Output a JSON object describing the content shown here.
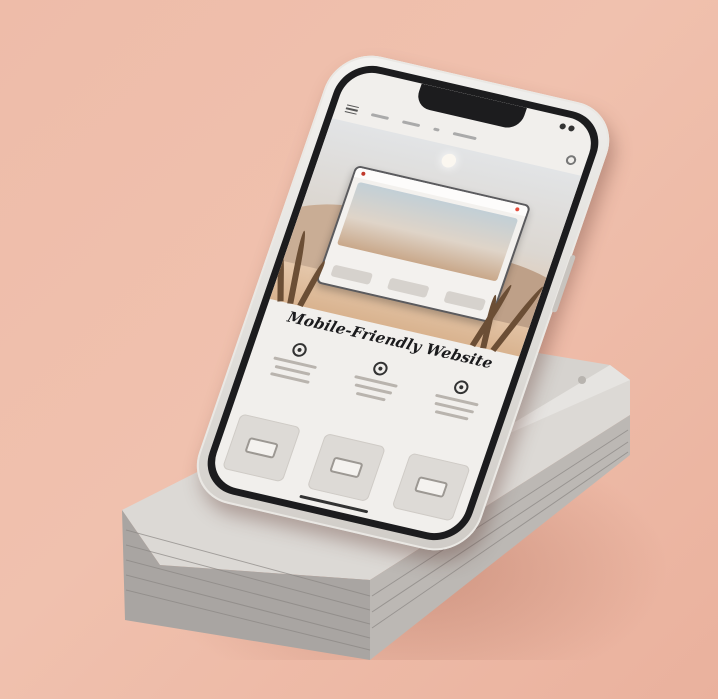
{
  "headline": "Mobile-Friendly Website",
  "colors": {
    "background": "#eebca9",
    "phone_frame": "#1c1c1e",
    "phone_shell": "#e4e2df",
    "screen": "#f1efec"
  },
  "icons": {
    "menu": "hamburger-icon",
    "settings": "gear-icon",
    "features": [
      "location-icon",
      "location-icon",
      "eye-icon"
    ],
    "tiles": [
      "image-icon",
      "image-icon",
      "image-icon"
    ]
  }
}
